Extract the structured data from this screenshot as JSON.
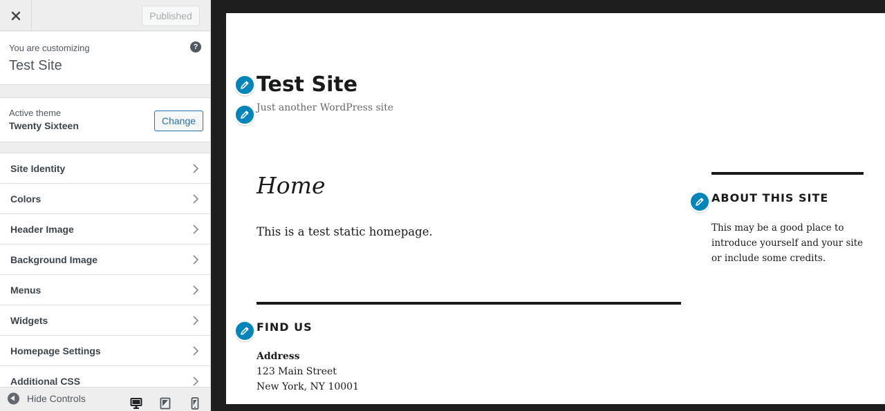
{
  "sidebar": {
    "header": {
      "close_icon": "close-icon",
      "published_label": "Published"
    },
    "info": {
      "customizing_label": "You are customizing",
      "site_name": "Test Site",
      "help_icon": "question-icon",
      "help_glyph": "?"
    },
    "theme": {
      "label": "Active theme",
      "name": "Twenty Sixteen",
      "change_label": "Change"
    },
    "sections": [
      {
        "label": "Site Identity"
      },
      {
        "label": "Colors"
      },
      {
        "label": "Header Image"
      },
      {
        "label": "Background Image"
      },
      {
        "label": "Menus"
      },
      {
        "label": "Widgets"
      },
      {
        "label": "Homepage Settings"
      },
      {
        "label": "Additional CSS"
      }
    ],
    "footer": {
      "hide_label": "Hide Controls",
      "devices": [
        "desktop-icon",
        "tablet-icon",
        "mobile-icon"
      ]
    }
  },
  "preview": {
    "site_title": "Test Site",
    "tagline": "Just another WordPress site",
    "page_title": "Home",
    "page_content": "This is a test static homepage.",
    "sidebar_widget": {
      "title": "ABOUT THIS SITE",
      "text": "This may be a good place to introduce yourself and your site or include some credits."
    },
    "footer_widget": {
      "title": "FIND US",
      "address_label": "Address",
      "address_line1": "123 Main Street",
      "address_line2": "New York, NY 10001"
    },
    "edit_shortcut_icon": "pencil-icon"
  },
  "colors": {
    "accent": "#0085ba",
    "button_blue": "#2271b1",
    "frame": "#1e1e1e"
  }
}
